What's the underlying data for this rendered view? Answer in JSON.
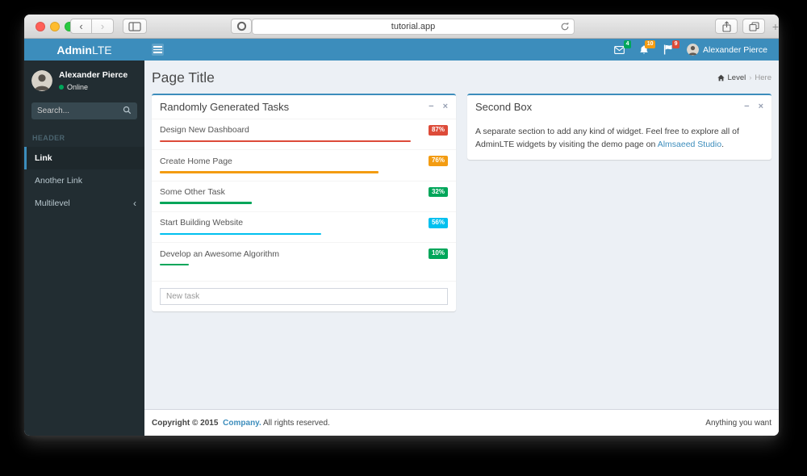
{
  "browser": {
    "url": "tutorial.app",
    "traffic_lights": {
      "close": "#ff5f57",
      "minimize": "#febc2e",
      "zoom": "#28c940"
    },
    "new_tab_glyph": "+",
    "back_glyph": "‹",
    "forward_glyph": "›"
  },
  "app": {
    "brand": {
      "bold": "Admin",
      "light": "LTE"
    },
    "navbar": {
      "messages_badge": "4",
      "notifications_badge": "10",
      "tasks_badge": "9",
      "user_name": "Alexander Pierce"
    },
    "sidebar": {
      "user": {
        "name": "Alexander Pierce",
        "status": "Online"
      },
      "search_placeholder": "Search...",
      "section_label": "HEADER",
      "items": [
        {
          "label": "Link",
          "active": true
        },
        {
          "label": "Another Link",
          "active": false
        },
        {
          "label": "Multilevel",
          "active": false,
          "chevron": "‹"
        }
      ]
    },
    "content": {
      "page_title": "Page Title",
      "breadcrumb": {
        "level": "Level",
        "separator": "›",
        "current": "Here"
      },
      "tasks_box": {
        "title": "Randomly Generated Tasks",
        "collapse_glyph": "−",
        "close_glyph": "×",
        "tasks": [
          {
            "label": "Design New Dashboard",
            "percent": 87,
            "color": "#dd4b39"
          },
          {
            "label": "Create Home Page",
            "percent": 76,
            "color": "#f39c12"
          },
          {
            "label": "Some Other Task",
            "percent": 32,
            "color": "#00a65a"
          },
          {
            "label": "Start Building Website",
            "percent": 56,
            "color": "#00c0ef"
          },
          {
            "label": "Develop an Awesome Algorithm",
            "percent": 10,
            "color": "#00a65a"
          }
        ],
        "new_task_placeholder": "New task"
      },
      "second_box": {
        "title": "Second Box",
        "collapse_glyph": "−",
        "close_glyph": "×",
        "body_before_link": "A separate section to add any kind of widget. Feel free to explore all of AdminLTE widgets by visiting the demo page on ",
        "link_text": "Almsaeed Studio",
        "body_after_link": "."
      }
    },
    "footer": {
      "copyright_prefix": "Copyright © 2015",
      "company_link": "Company.",
      "rights_text": "All rights reserved.",
      "right_text": "Anything you want"
    }
  },
  "colors": {
    "brand_blue": "#3c8dbc",
    "sidebar_dark": "#222d32",
    "badge_green": "#00a65a",
    "badge_yellow": "#f39c12",
    "badge_red": "#dd4b39",
    "badge_aqua": "#00c0ef",
    "online_dot": "#00a65a"
  }
}
